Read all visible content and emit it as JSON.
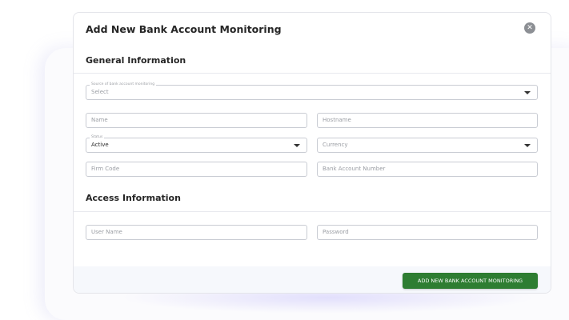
{
  "modal": {
    "title": "Add New Bank Account Monitoring",
    "close_icon": "close-circle-icon"
  },
  "general": {
    "section_title": "General Information",
    "source": {
      "label": "Source of bank account monitoring",
      "value": "Select"
    },
    "name": {
      "placeholder": "Name"
    },
    "hostname": {
      "placeholder": "Hostname"
    },
    "status": {
      "label": "Status",
      "value": "Active"
    },
    "currency": {
      "placeholder": "Currency"
    },
    "firm_code": {
      "placeholder": "Firm Code"
    },
    "bank_account_number": {
      "placeholder": "Bank Account Number"
    }
  },
  "access": {
    "section_title": "Access Information",
    "user_name": {
      "placeholder": "User Name"
    },
    "password": {
      "placeholder": "Password"
    }
  },
  "footer": {
    "submit_label": "ADD NEW BANK ACCOUNT MONITORING",
    "submit_color": "#2e7d32"
  }
}
